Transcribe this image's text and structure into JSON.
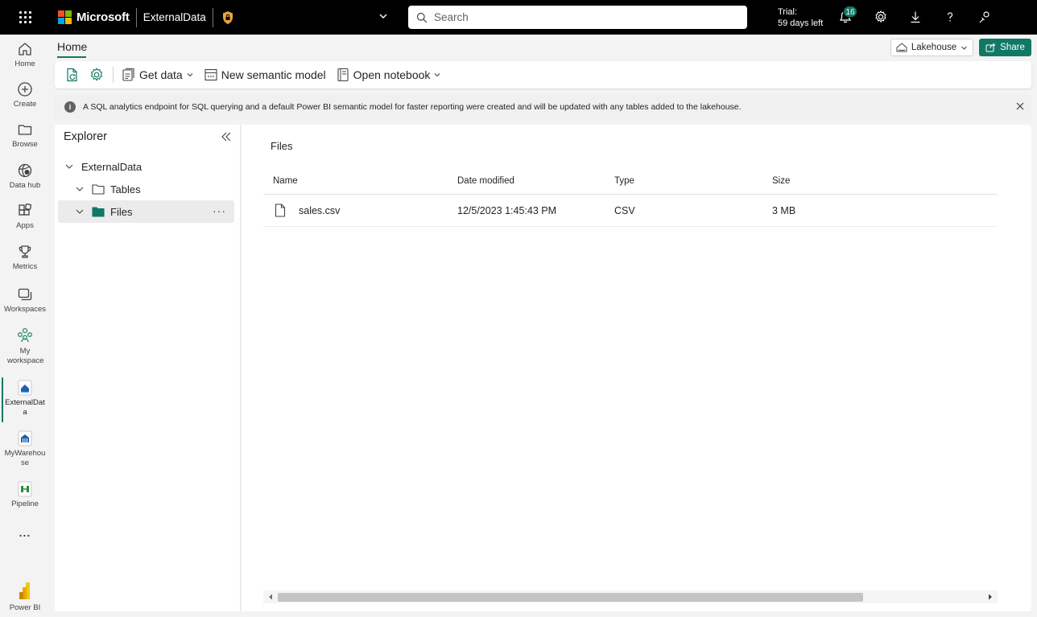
{
  "topbar": {
    "brand": "Microsoft",
    "app_title": "ExternalData",
    "search_placeholder": "Search",
    "trial_line1": "Trial:",
    "trial_line2": "59 days left",
    "notifications_count": "16"
  },
  "rail": {
    "items": [
      {
        "label": "Home",
        "icon": "home-icon"
      },
      {
        "label": "Create",
        "icon": "plus-circle-icon"
      },
      {
        "label": "Browse",
        "icon": "folder-icon"
      },
      {
        "label": "Data hub",
        "icon": "data-hub-icon"
      },
      {
        "label": "Apps",
        "icon": "apps-icon"
      },
      {
        "label": "Metrics",
        "icon": "trophy-icon"
      },
      {
        "label": "Workspaces",
        "icon": "workspaces-icon"
      },
      {
        "label": "My workspace",
        "icon": "people-icon"
      },
      {
        "label": "ExternalData",
        "icon": "lakehouse-icon"
      },
      {
        "label": "MyWarehouse",
        "icon": "warehouse-icon"
      },
      {
        "label": "Pipeline",
        "icon": "pipeline-icon"
      },
      {
        "label": "Power BI",
        "icon": "powerbi-icon"
      }
    ],
    "more_label": "..."
  },
  "header": {
    "home_tab": "Home",
    "lakehouse_label": "Lakehouse",
    "share_label": "Share"
  },
  "toolbar": {
    "get_data": "Get data",
    "new_semantic_model": "New semantic model",
    "open_notebook": "Open notebook"
  },
  "infobar": {
    "message": "A SQL analytics endpoint for SQL querying and a default Power BI semantic model for faster reporting were created and will be updated with any tables added to the lakehouse."
  },
  "explorer": {
    "title": "Explorer",
    "root": "ExternalData",
    "tables": "Tables",
    "files": "Files"
  },
  "files": {
    "title": "Files",
    "columns": [
      "Name",
      "Date modified",
      "Type",
      "Size"
    ],
    "rows": [
      {
        "name": "sales.csv",
        "date_modified": "12/5/2023 1:45:43 PM",
        "type": "CSV",
        "size": "3 MB"
      }
    ]
  },
  "colors": {
    "accent": "#117865",
    "topbar_bg": "#000000"
  }
}
